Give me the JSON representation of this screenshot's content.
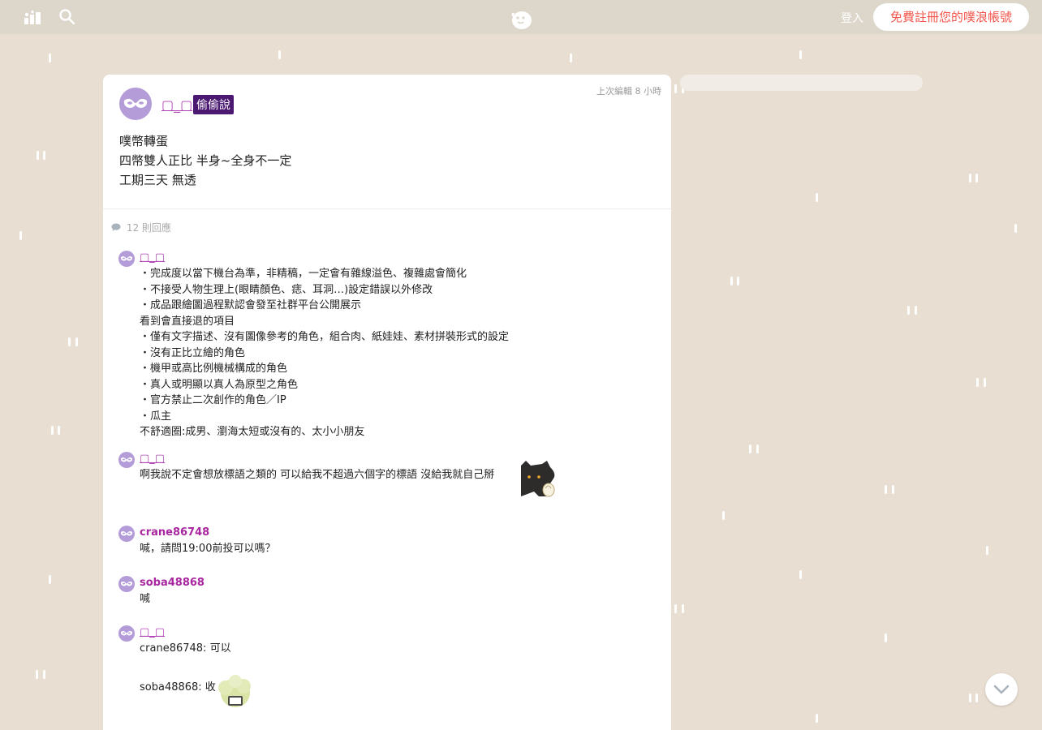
{
  "topbar": {
    "login_label": "登入",
    "signup_label": "免費註冊您的噗浪帳號",
    "icons": [
      "stats-icon",
      "search-icon",
      "plurk-logo"
    ]
  },
  "post": {
    "poster_name": "▢_▢",
    "badge": "偷偷說",
    "edited": "上次編輯 8 小時",
    "lines": [
      "噗幣轉蛋",
      "四幣雙人正比 半身~全身不一定",
      "工期三天 無透"
    ],
    "response_count": "12 則回應"
  },
  "responses": [
    {
      "name": "▢_▢",
      "lines": [
        "・完成度以當下機台為準，非精稿，一定會有雜線溢色、複雜處會簡化",
        "・不接受人物生理上(眼睛顏色、痣、耳洞…)設定錯誤以外修改",
        "・成品跟繪圖過程默認會發至社群平台公開展示",
        "看到會直接退的項目",
        "・僅有文字描述、沒有圖像參考的角色，組合肉、紙娃娃、素材拼裝形式的設定",
        "・沒有正比立繪的角色",
        "・機甲或高比例機械構成的角色",
        "・真人或明顯以真人為原型之角色",
        "・官方禁止二次創作的角色／IP",
        "・瓜主",
        "不舒適圈:成男、瀏海太短或沒有的、太小小朋友"
      ]
    },
    {
      "name": "▢_▢",
      "lines": [
        "啊我說不定會想放標語之類的 可以給我不超過六個字的標語 沒給我就自己掰"
      ]
    },
    {
      "name": "crane86748",
      "lines": [
        "喊，請問19:00前投可以嗎？"
      ]
    },
    {
      "name": "soba48868",
      "lines": [
        "喊"
      ]
    },
    {
      "name": "▢_▢",
      "lines": [
        "crane86748: 可以",
        "soba48868: 收"
      ]
    }
  ],
  "colors": {
    "background": "#e8ded2",
    "topbar": "#ddd6cb",
    "accent": "#f4574c",
    "username": "#a8269f",
    "badge": "#4b1872"
  }
}
